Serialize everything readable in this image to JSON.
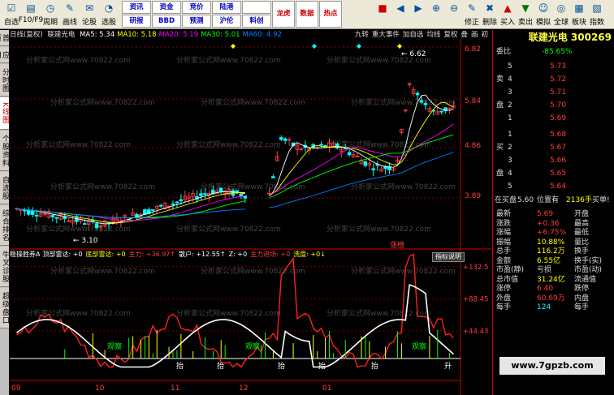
{
  "toolbar": {
    "buttons": [
      {
        "label": "自选",
        "icon": "checklist-icon"
      },
      {
        "label": "F10/F9",
        "icon": "f10-icon"
      },
      {
        "label": "周期",
        "icon": "clock-icon"
      },
      {
        "label": "画线",
        "icon": "pen-icon"
      },
      {
        "label": "论股",
        "icon": "chat-icon"
      },
      {
        "label": "选股",
        "icon": "gauge-icon"
      }
    ],
    "grid": [
      "资讯",
      "资金",
      "竞价",
      "陆港",
      "",
      "研报",
      "BBD",
      "预测",
      "沪伦",
      "料创"
    ],
    "grid2": [
      "龙虎",
      "数据",
      "热点",
      "",
      "",
      "",
      "",
      "",
      "",
      ""
    ],
    "right_buttons": [
      {
        "label": "",
        "icon": "red-box-icon"
      },
      {
        "label": "",
        "icon": "prev-icon"
      },
      {
        "label": "",
        "icon": "next-icon"
      },
      {
        "label": "",
        "icon": "zoom-in-icon"
      },
      {
        "label": "",
        "icon": "zoom-out-icon"
      },
      {
        "label": "修正",
        "icon": "fix-icon"
      },
      {
        "label": "删除",
        "icon": "delete-icon"
      },
      {
        "label": "买入",
        "icon": "buy-icon"
      },
      {
        "label": "卖出",
        "icon": "sell-icon"
      },
      {
        "label": "模拟",
        "icon": "sim-icon"
      },
      {
        "label": "全球",
        "icon": "globe-icon"
      },
      {
        "label": "板块",
        "icon": "sector-icon"
      },
      {
        "label": "指数",
        "icon": "index-icon"
      }
    ]
  },
  "sidetabs": [
    "首页",
    "应用",
    "分时图",
    "K线图",
    "个股资料",
    "自选股",
    "综合排名",
    "牛叉诊股",
    "超级盘口"
  ],
  "chart": {
    "mode": "日线(复权)",
    "stock": "联建光电",
    "ma": [
      {
        "label": "MA5: 5.34",
        "color": "#ffffff"
      },
      {
        "label": "MA10: 5.18",
        "color": "#ffff00"
      },
      {
        "label": "MA20: 5.19",
        "color": "#ff00ff"
      },
      {
        "label": "MA30: 5.01",
        "color": "#00ff00"
      },
      {
        "label": "MA60: 4.92",
        "color": "#0080ff"
      }
    ],
    "tabs": [
      "九转",
      "重大事件",
      "加自选",
      "均线",
      "复权",
      "叠",
      "画",
      "初"
    ],
    "price_labels": [
      "6.82",
      "5.84",
      "4.86",
      "3.89"
    ],
    "high_label": "6.62",
    "low_label": "3.10",
    "zhang_label": "涨榜",
    "watermark_text": "分析家公式网www.70822.com",
    "month_labels": [
      "09",
      "10",
      "11",
      "12",
      "01"
    ],
    "ind_labels": [
      "+132.5",
      "+88.45",
      "+44.43"
    ],
    "signal_labels": [
      "观察",
      "观察",
      "观察"
    ],
    "bottom_labels": [
      "抬",
      "抬",
      "抬",
      "抬",
      "抬",
      "升"
    ]
  },
  "indicator": {
    "name": "稳操胜券A",
    "items": [
      {
        "label": "顶部雷达: +0",
        "color": "#ffffff"
      },
      {
        "label": "底部雷达: +0",
        "color": "#ffff00"
      },
      {
        "label": "主力: +36.97↑",
        "color": "#ff3c3c"
      },
      {
        "label": "散户: +12.55↑",
        "color": "#ffffff"
      },
      {
        "label": "Z: +0",
        "color": "#ffffff"
      },
      {
        "label": "主力进场: +0",
        "color": "#ff3c3c"
      },
      {
        "label": "洗盘: +0↓",
        "color": "#ffff00"
      }
    ],
    "btn": "指标说明"
  },
  "quote": {
    "title": "联建光电 300269",
    "weibi_label": "委比",
    "weibi_value": "-85.65%",
    "sell_label": "卖盘",
    "buy_label": "买盘",
    "sell": [
      {
        "lv": "5",
        "price": "5.73"
      },
      {
        "lv": "4",
        "price": "5.72"
      },
      {
        "lv": "3",
        "price": "5.71"
      },
      {
        "lv": "2",
        "price": "5.70"
      },
      {
        "lv": "1",
        "price": "5.69"
      }
    ],
    "buy": [
      {
        "lv": "1",
        "price": "5.68"
      },
      {
        "lv": "2",
        "price": "5.67"
      },
      {
        "lv": "3",
        "price": "5.66"
      },
      {
        "lv": "4",
        "price": "5.65"
      },
      {
        "lv": "5",
        "price": "5.64"
      }
    ],
    "note_prefix": "在买盘",
    "note_price": "5.60",
    "note_mid": "位置有",
    "note_vol": "2136手",
    "note_suffix": "买单!",
    "stats": [
      {
        "l1": "最新",
        "v1": "5.69",
        "c1": "red",
        "l2": "开盘"
      },
      {
        "l1": "涨跌",
        "v1": "+0.36",
        "c1": "red",
        "l2": "最高"
      },
      {
        "l1": "涨幅",
        "v1": "+6.75%",
        "c1": "red",
        "l2": "最低"
      },
      {
        "l1": "振幅",
        "v1": "10.88%",
        "c1": "yellow",
        "l2": "量比"
      },
      {
        "l1": "总手",
        "v1": "116.2万",
        "c1": "yellow",
        "l2": "换手"
      },
      {
        "l1": "金额",
        "v1": "6.55亿",
        "c1": "yellow",
        "l2": "换手(实)"
      },
      {
        "l1": "市盈(静)",
        "v1": "亏损",
        "c1": "white",
        "l2": "市盈(动)"
      },
      {
        "l1": "总市值",
        "v1": "31.24亿",
        "c1": "yellow",
        "l2": "流通值"
      },
      {
        "l1": "涨停",
        "v1": "6.40",
        "c1": "red",
        "l2": "跌停"
      },
      {
        "l1": "外盘",
        "v1": "60.69万",
        "c1": "red",
        "l2": "内盘"
      },
      {
        "l1": "每手",
        "v1": "124",
        "c1": "cyan",
        "l2": "每手"
      }
    ]
  },
  "site_badge": "www.7gpzb.com"
}
